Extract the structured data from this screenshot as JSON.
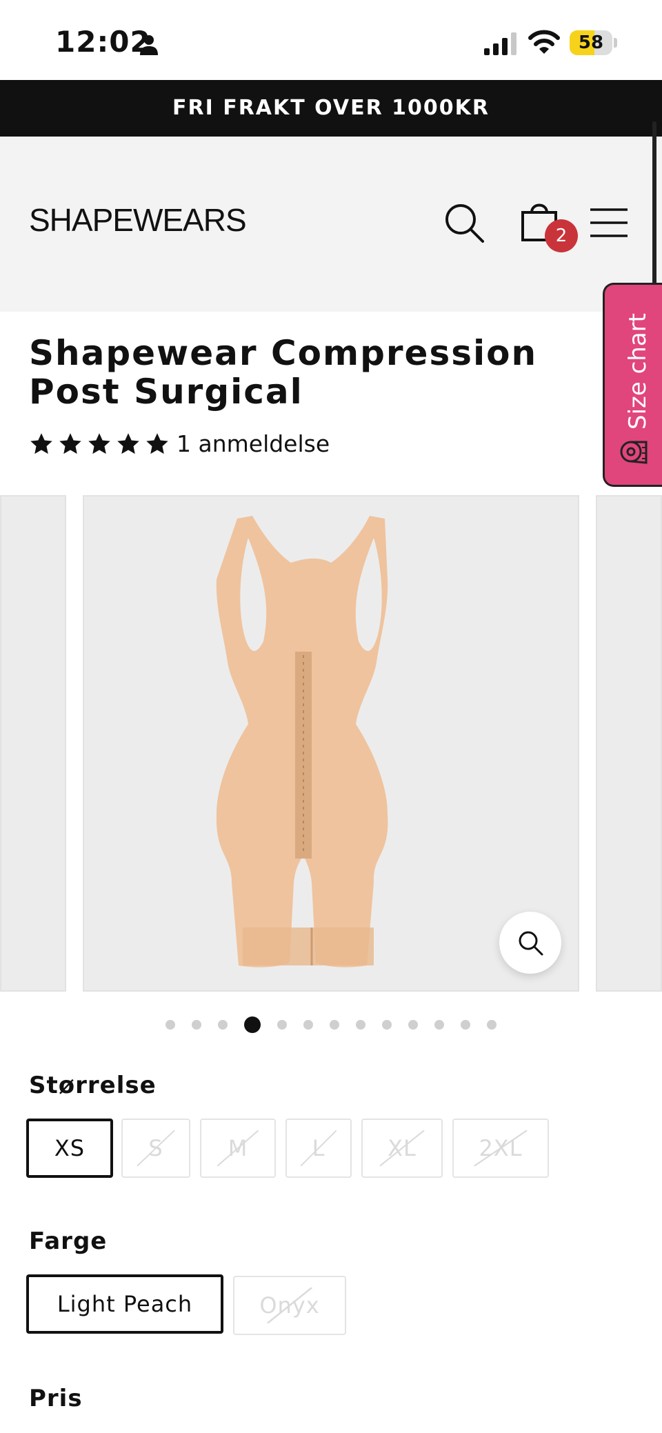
{
  "status_bar": {
    "time": "12:02",
    "battery": "58",
    "battery_level": 0.58
  },
  "promo": {
    "text": "FRI FRAKT OVER 1000KR"
  },
  "header": {
    "logo": "SHAPEWEARS",
    "cart_count": "2"
  },
  "size_chart": {
    "label": "Size chart"
  },
  "product": {
    "title": "Shapewear Compression Post Surgical",
    "rating": 5,
    "review_count": "1 anmeldelse"
  },
  "gallery": {
    "total_images": 13,
    "current_index": 4
  },
  "options": {
    "size": {
      "label": "Størrelse",
      "values": [
        "XS",
        "S",
        "M",
        "L",
        "XL",
        "2XL"
      ],
      "selected": "XS",
      "unavailable": [
        "S",
        "M",
        "L",
        "XL",
        "2XL"
      ]
    },
    "color": {
      "label": "Farge",
      "values": [
        "Light Peach",
        "Onyx"
      ],
      "selected": "Light Peach",
      "unavailable": [
        "Onyx"
      ]
    }
  },
  "price": {
    "label": "Pris"
  },
  "colors": {
    "promo_bg": "#111111",
    "badge": "#c9343a",
    "size_chart_tab": "#e0457b",
    "product": "#efc39e"
  }
}
